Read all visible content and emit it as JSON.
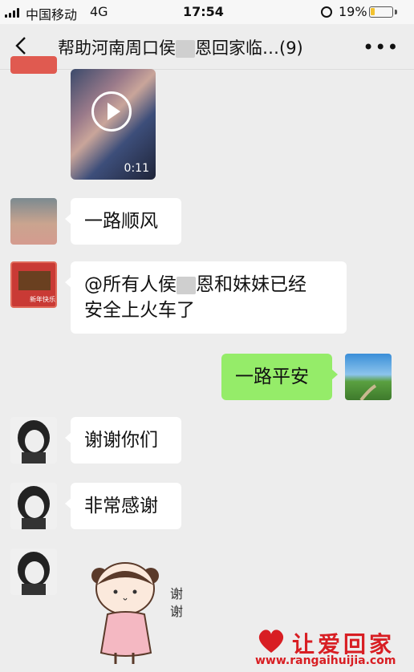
{
  "status_bar": {
    "carrier": "中国移动",
    "network": "4G",
    "time": "17:54",
    "battery": "19%",
    "battery_level": 0.19
  },
  "header": {
    "title_part1": "帮助河南周口侯",
    "title_part2": "恩回家临…(9)"
  },
  "video": {
    "duration": "0:11"
  },
  "messages": [
    {
      "side": "left",
      "text": "一路顺风"
    },
    {
      "side": "left",
      "text_part1": "@所有人侯",
      "text_part2": "恩和妹妹已经",
      "line2": "安全上火车了"
    },
    {
      "side": "right",
      "text": "一路平安"
    },
    {
      "side": "left",
      "text": "谢谢你们"
    },
    {
      "side": "left",
      "text": "非常感谢"
    }
  ],
  "avatar_badge": "新年快乐",
  "sticker_text": [
    "谢",
    "谢"
  ],
  "watermark": {
    "title": "让爱回家",
    "url": "www.rangaihuijia.com"
  },
  "colors": {
    "accent_green": "#95ec69",
    "watermark_red": "#d81e23",
    "background": "#ededed"
  }
}
